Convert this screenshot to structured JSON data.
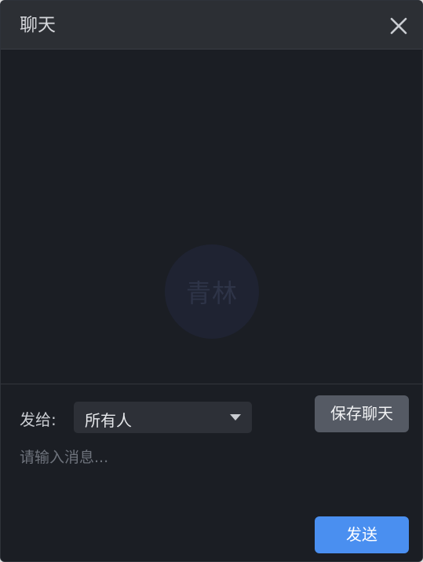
{
  "window": {
    "title": "聊天",
    "close_icon": "close-icon"
  },
  "messages": {
    "watermark_text": "青林"
  },
  "compose": {
    "send_to_label": "发给:",
    "recipient": {
      "selected": "所有人"
    },
    "save_chat_label": "保存聊天",
    "input_placeholder": "请输入消息...",
    "send_label": "发送"
  },
  "colors": {
    "background": "#1b1e24",
    "titlebar": "#2c2f34",
    "accent": "#4a8ff0",
    "secondary_button": "#555a64"
  }
}
